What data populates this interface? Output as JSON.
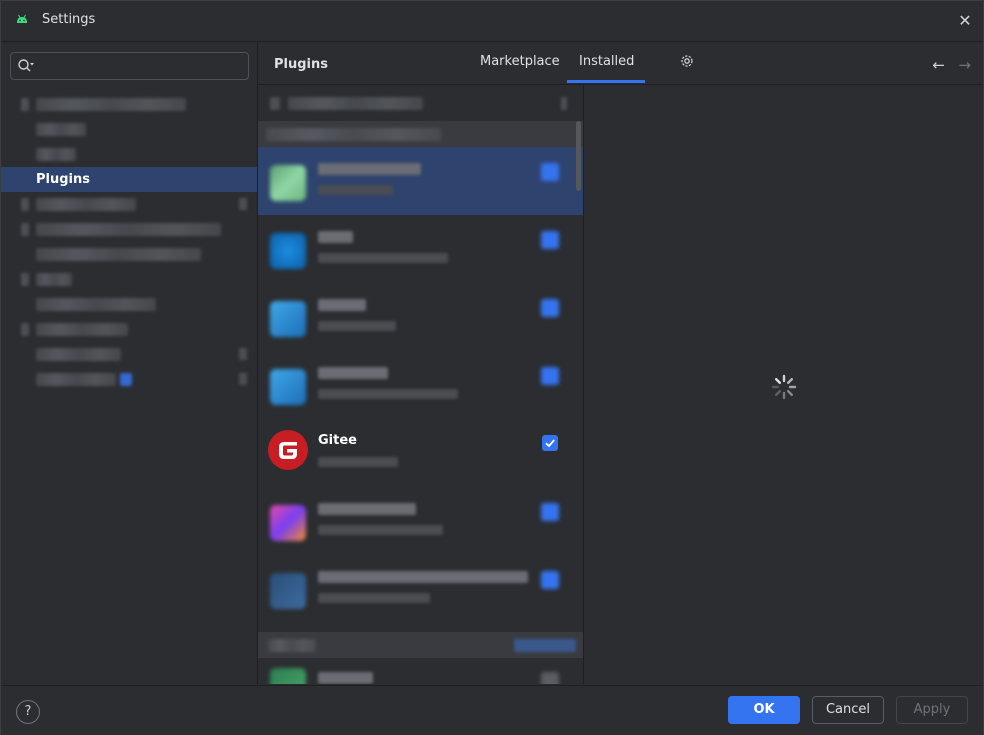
{
  "window": {
    "title": "Settings",
    "app_icon": "android-icon",
    "close_icon": "close-icon"
  },
  "sidebar": {
    "search_placeholder": "",
    "selected_item": "Plugins"
  },
  "plugins": {
    "title": "Plugins",
    "tabs": [
      {
        "label": "Marketplace"
      },
      {
        "label": "Installed"
      }
    ],
    "active_tab": "Installed",
    "visible_plugin": {
      "name": "Gitee",
      "enabled": true
    }
  },
  "footer": {
    "ok_label": "OK",
    "cancel_label": "Cancel",
    "apply_label": "Apply",
    "help_label": "?"
  },
  "colors": {
    "accent": "#3574f0",
    "selection": "#2e436e",
    "background": "#2b2d30"
  }
}
